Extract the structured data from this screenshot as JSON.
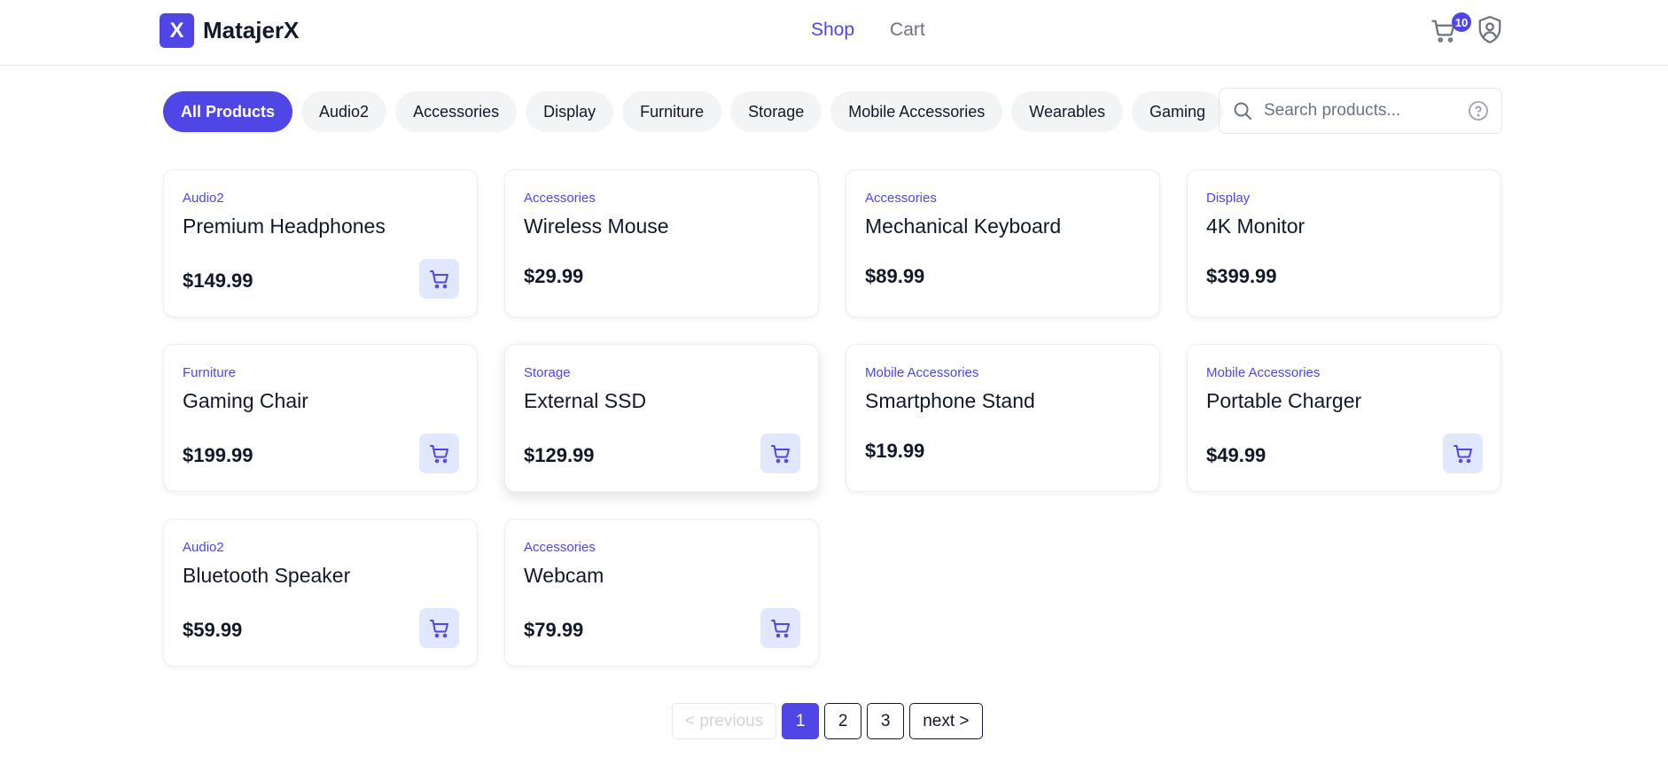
{
  "brand": {
    "logo_letter": "X",
    "name": "MatajerX",
    "accent_color": "#4f46e5"
  },
  "nav": {
    "shop": "Shop",
    "cart": "Cart"
  },
  "header_icons": {
    "cart_icon": "cart-icon",
    "cart_count": "10",
    "profile_icon": "shield-user-icon"
  },
  "filters": [
    "All Products",
    "Audio2",
    "Accessories",
    "Display",
    "Furniture",
    "Storage",
    "Mobile Accessories",
    "Wearables",
    "Gaming"
  ],
  "active_filter": "All Products",
  "search": {
    "placeholder": "Search products...",
    "value": ""
  },
  "products": [
    {
      "category": "Audio2",
      "name": "Premium Headphones",
      "price": "$149.99",
      "add_to_cart": true
    },
    {
      "category": "Accessories",
      "name": "Wireless Mouse",
      "price": "$29.99",
      "add_to_cart": false
    },
    {
      "category": "Accessories",
      "name": "Mechanical Keyboard",
      "price": "$89.99",
      "add_to_cart": false
    },
    {
      "category": "Display",
      "name": "4K Monitor",
      "price": "$399.99",
      "add_to_cart": false
    },
    {
      "category": "Furniture",
      "name": "Gaming Chair",
      "price": "$199.99",
      "add_to_cart": true
    },
    {
      "category": "Storage",
      "name": "External SSD",
      "price": "$129.99",
      "add_to_cart": true
    },
    {
      "category": "Mobile Accessories",
      "name": "Smartphone Stand",
      "price": "$19.99",
      "add_to_cart": false
    },
    {
      "category": "Mobile Accessories",
      "name": "Portable Charger",
      "price": "$49.99",
      "add_to_cart": true
    },
    {
      "category": "Audio2",
      "name": "Bluetooth Speaker",
      "price": "$59.99",
      "add_to_cart": true
    },
    {
      "category": "Accessories",
      "name": "Webcam",
      "price": "$79.99",
      "add_to_cart": true
    }
  ],
  "pagination": {
    "previous": "< previous",
    "pages": [
      "1",
      "2",
      "3"
    ],
    "current": "1",
    "next": "next >"
  }
}
